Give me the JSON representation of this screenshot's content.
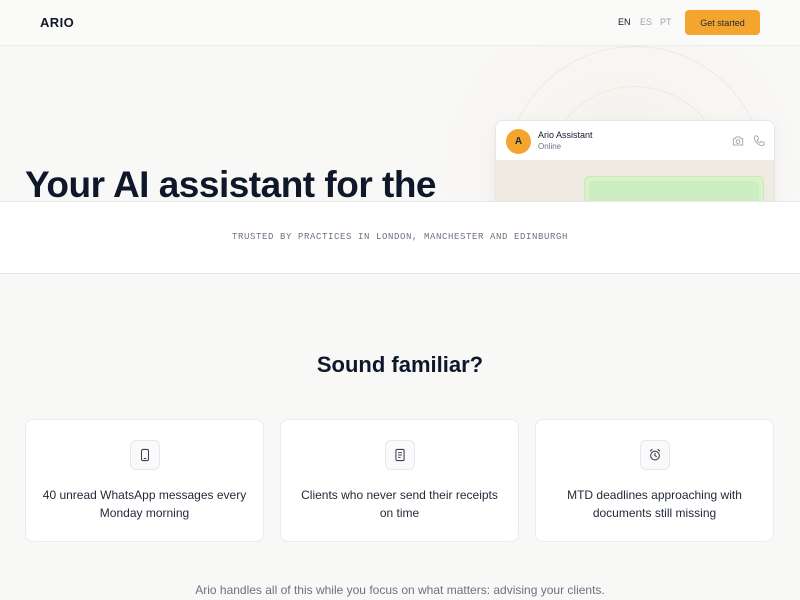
{
  "header": {
    "logo": "ARIO",
    "languages": [
      "EN",
      "ES",
      "PT"
    ],
    "active_language": "EN",
    "cta_label": "Get started"
  },
  "hero": {
    "title": "Your AI assistant for the"
  },
  "chat_preview": {
    "avatar_initial": "A",
    "contact_name": "Ario Assistant",
    "contact_status": "Online",
    "icons": [
      "camera-icon",
      "phone-icon"
    ]
  },
  "trusted": {
    "text": "TRUSTED BY PRACTICES IN LONDON, MANCHESTER AND EDINBURGH"
  },
  "familiar": {
    "title": "Sound familiar?",
    "cards": [
      {
        "icon": "smartphone-icon",
        "text": "40 unread WhatsApp messages every Monday morning"
      },
      {
        "icon": "receipt-icon",
        "text": "Clients who never send their receipts on time"
      },
      {
        "icon": "alarm-clock-icon",
        "text": "MTD deadlines approaching with documents still missing"
      }
    ],
    "footer": "Ario handles all of this while you focus on what matters: advising your clients."
  },
  "colors": {
    "accent": "#f4a52d",
    "chat_bubble": "#d9f2c9",
    "chat_background": "#efeae2",
    "text_dark": "#0f172a"
  }
}
